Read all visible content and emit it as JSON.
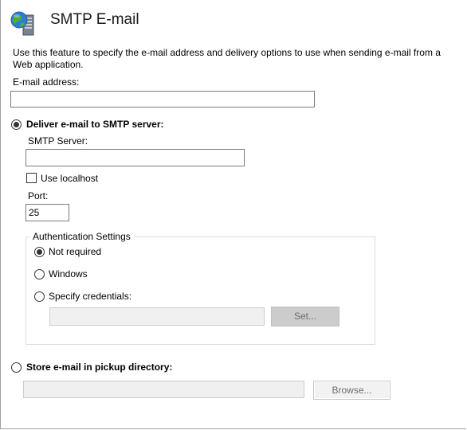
{
  "header": {
    "icon": "smtp-globe-server-icon",
    "title": "SMTP E-mail"
  },
  "description": "Use this feature to specify the e-mail address and delivery options to use when sending e-mail from a Web application.",
  "email": {
    "label": "E-mail address:",
    "value": ""
  },
  "deliver_smtp": {
    "label": "Deliver e-mail to SMTP server:",
    "selected": true,
    "smtp_server_label": "SMTP Server:",
    "smtp_server_value": "",
    "use_localhost_label": "Use localhost",
    "use_localhost_checked": false,
    "port_label": "Port:",
    "port_value": "25"
  },
  "authentication": {
    "legend": "Authentication Settings",
    "options": [
      {
        "label": "Not required",
        "selected": true
      },
      {
        "label": "Windows",
        "selected": false
      },
      {
        "label": "Specify credentials:",
        "selected": false
      }
    ],
    "credentials_value": "",
    "set_button": "Set..."
  },
  "pickup": {
    "label": "Store e-mail in pickup directory:",
    "selected": false,
    "directory_value": "",
    "browse_button": "Browse..."
  }
}
